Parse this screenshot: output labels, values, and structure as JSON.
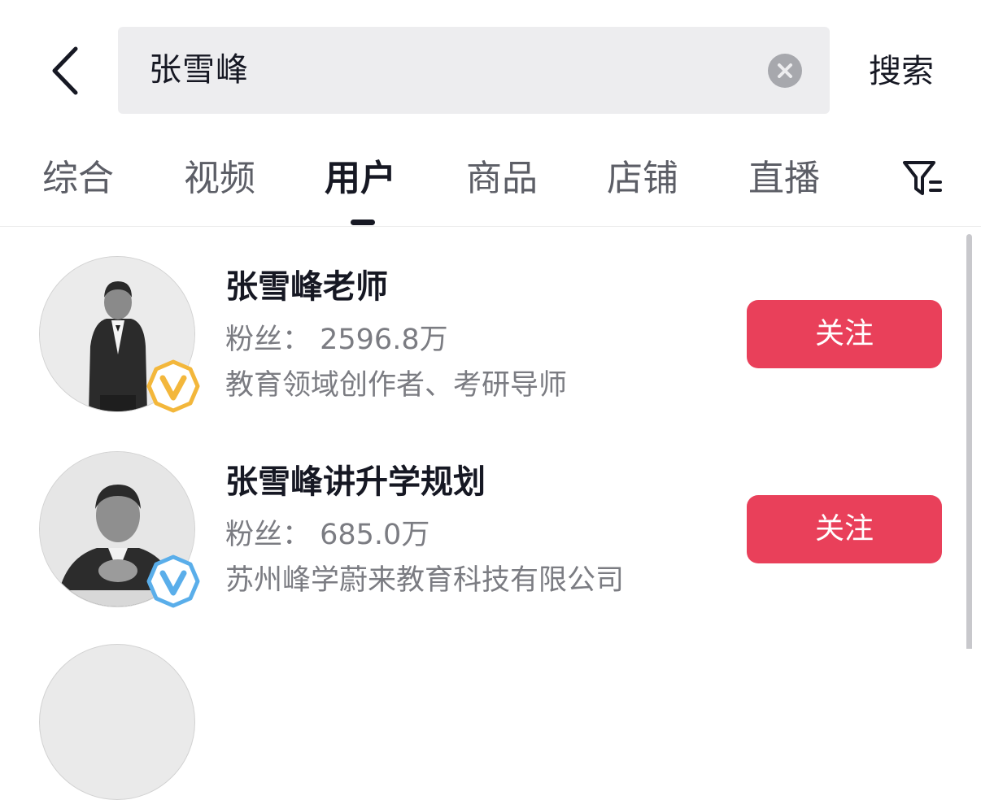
{
  "search": {
    "query": "张雪峰",
    "submit_label": "搜索"
  },
  "tabs": [
    {
      "label": "综合"
    },
    {
      "label": "视频"
    },
    {
      "label": "用户"
    },
    {
      "label": "商品"
    },
    {
      "label": "店铺"
    },
    {
      "label": "直播"
    }
  ],
  "active_tab": "用户",
  "icons": {
    "back": "chevron-left-icon",
    "clear": "clear-circle-icon",
    "filter": "filter-icon",
    "verified_gold": "verified-badge-gold-icon",
    "verified_blue": "verified-badge-blue-icon"
  },
  "colors": {
    "follow_button": "#e9405a",
    "badge_gold": "#f3b73b",
    "badge_blue": "#5aaeea"
  },
  "users": [
    {
      "name": "张雪峰老师",
      "fans": "粉丝： 2596.8万",
      "desc": "教育领域创作者、考研导师",
      "follow_label": "关注",
      "badge": "gold"
    },
    {
      "name": "张雪峰讲升学规划",
      "fans": "粉丝： 685.0万",
      "desc": "苏州峰学蔚来教育科技有限公司",
      "follow_label": "关注",
      "badge": "blue"
    }
  ]
}
